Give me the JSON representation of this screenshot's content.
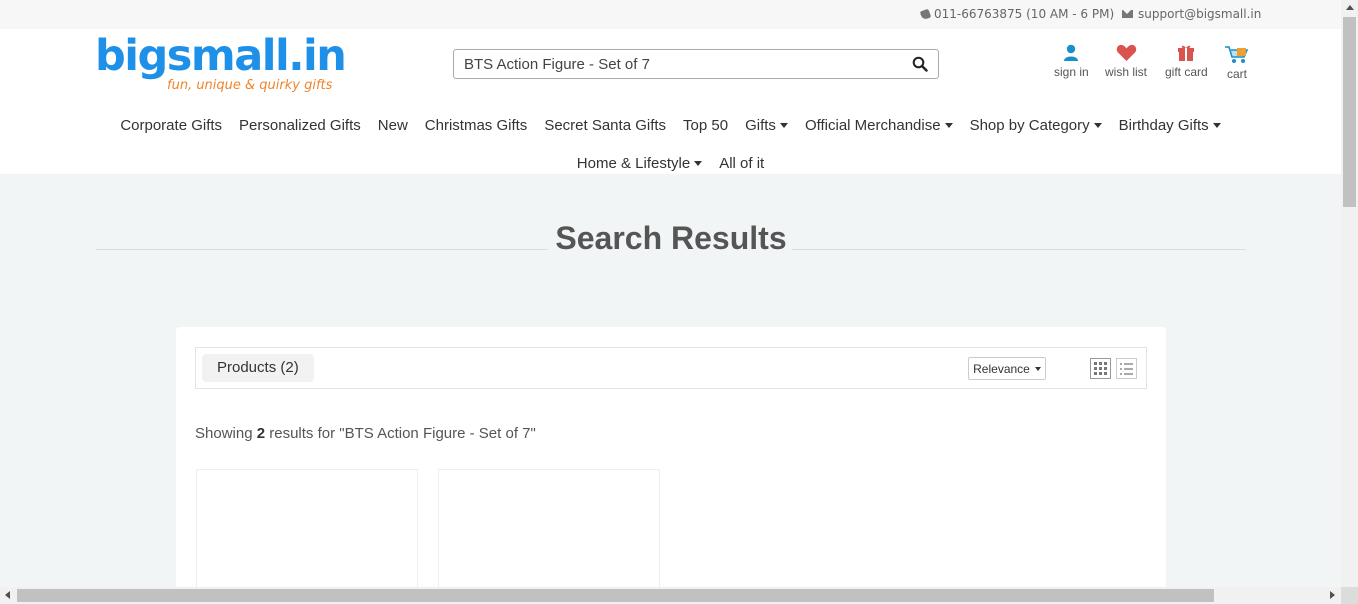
{
  "topbar": {
    "phone": "011-66763875 (10 AM - 6 PM)",
    "email": "support@bigsmall.in"
  },
  "logo": {
    "name": "bigsmall.in",
    "tagline": "fun, unique & quirky gifts"
  },
  "search": {
    "value": "BTS Action Figure - Set of 7",
    "icon": "search-icon"
  },
  "account_links": [
    {
      "label": "sign in",
      "icon": "user-icon",
      "color": "#1a8fc9"
    },
    {
      "label": "wish list",
      "icon": "heart-icon",
      "color": "#d9534f"
    },
    {
      "label": "gift card",
      "icon": "gift-icon",
      "color": "#d9534f"
    },
    {
      "label": "cart",
      "icon": "cart-icon",
      "color": "#1a8fc9"
    }
  ],
  "nav": {
    "row1": [
      {
        "label": "Corporate Gifts",
        "dropdown": false
      },
      {
        "label": "Personalized Gifts",
        "dropdown": false
      },
      {
        "label": "New",
        "dropdown": false
      },
      {
        "label": "Christmas Gifts",
        "dropdown": false
      },
      {
        "label": "Secret Santa Gifts",
        "dropdown": false
      },
      {
        "label": "Top 50",
        "dropdown": false
      },
      {
        "label": "Gifts",
        "dropdown": true
      },
      {
        "label": "Official Merchandise",
        "dropdown": true
      },
      {
        "label": "Shop by Category",
        "dropdown": true
      },
      {
        "label": "Birthday Gifts",
        "dropdown": true
      }
    ],
    "row2": [
      {
        "label": "Home & Lifestyle",
        "dropdown": true
      },
      {
        "label": "All of it",
        "dropdown": false
      }
    ]
  },
  "page_title": "Search Results",
  "results": {
    "tab_label": "Products (2)",
    "sort_label": "Relevance",
    "showing_prefix": "Showing ",
    "count": "2",
    "showing_suffix": " results for \"BTS Action Figure - Set of 7\""
  },
  "colors": {
    "brand_blue": "#1e90e8",
    "brand_orange": "#f0842c",
    "background": "#f2f5f5"
  }
}
